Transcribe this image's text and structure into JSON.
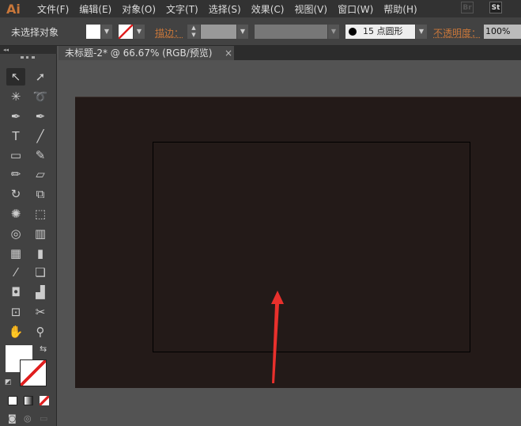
{
  "app": {
    "logo": "Ai",
    "bridge": "Br",
    "stock": "St"
  },
  "menu": [
    "文件(F)",
    "编辑(E)",
    "对象(O)",
    "文字(T)",
    "选择(S)",
    "效果(C)",
    "视图(V)",
    "窗口(W)",
    "帮助(H)"
  ],
  "control": {
    "selection": "未选择对象",
    "stroke_label": "描边：",
    "brush": "15 点圆形",
    "opacity_label": "不透明度：",
    "opacity_value": "100%"
  },
  "document": {
    "tab_title": "未标题-2* @ 66.67% (RGB/预览)",
    "close": "×"
  },
  "tools": [
    [
      "selection-tool",
      "↖"
    ],
    [
      "direct-selection-tool",
      "➚"
    ],
    [
      "magic-wand-tool",
      "✳"
    ],
    [
      "lasso-tool",
      "➰"
    ],
    [
      "pen-tool",
      "✒"
    ],
    [
      "curvature-tool",
      "✒"
    ],
    [
      "type-tool",
      "T"
    ],
    [
      "line-tool",
      "╱"
    ],
    [
      "rectangle-tool",
      "▭"
    ],
    [
      "paintbrush-tool",
      "✎"
    ],
    [
      "pencil-tool",
      "✏"
    ],
    [
      "eraser-tool",
      "▱"
    ],
    [
      "rotate-tool",
      "↻"
    ],
    [
      "scale-tool",
      "⧉"
    ],
    [
      "warp-tool",
      "✺"
    ],
    [
      "free-transform-tool",
      "⬚"
    ],
    [
      "shape-builder-tool",
      "◎"
    ],
    [
      "perspective-grid-tool",
      "▥"
    ],
    [
      "mesh-tool",
      "▦"
    ],
    [
      "gradient-tool",
      "▮"
    ],
    [
      "eyedropper-tool",
      "⁄"
    ],
    [
      "blend-tool",
      "❏"
    ],
    [
      "symbol-sprayer-tool",
      "◘"
    ],
    [
      "column-graph-tool",
      "▟"
    ],
    [
      "artboard-tool",
      "⊡"
    ],
    [
      "slice-tool",
      "✂"
    ],
    [
      "hand-tool",
      "✋"
    ],
    [
      "zoom-tool",
      "⚲"
    ]
  ],
  "colors": {
    "artboard": "#231a18",
    "canvas": "#535353",
    "arrow": "#e8302c",
    "accent": "#c9773a"
  }
}
